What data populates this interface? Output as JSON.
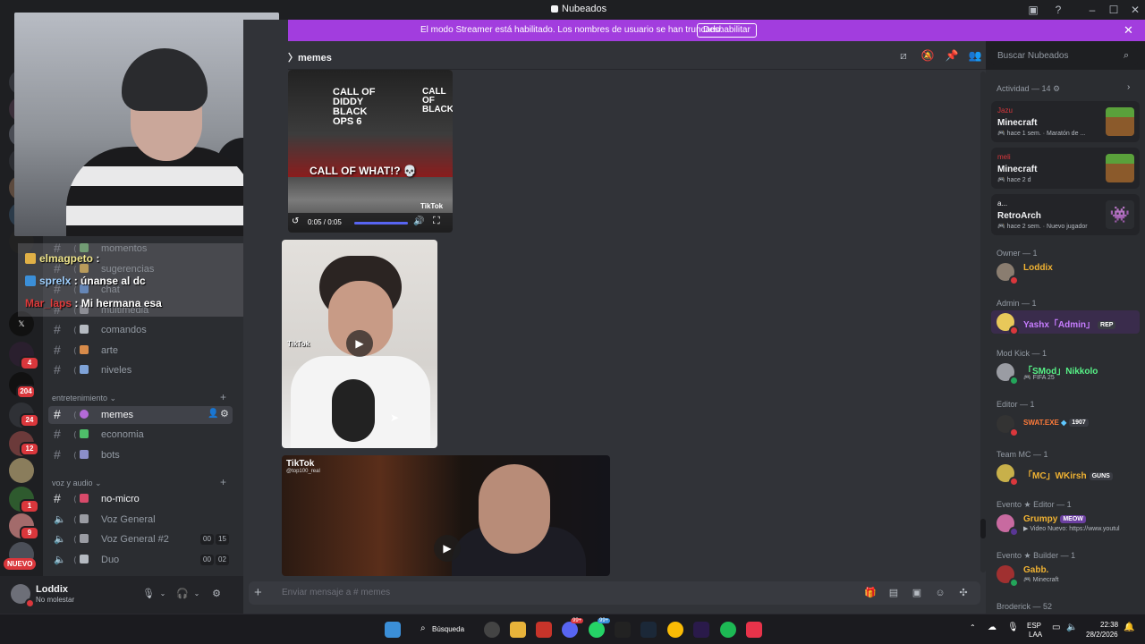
{
  "window": {
    "title": "Nubeados",
    "controls": [
      "–",
      "☐",
      "✕"
    ]
  },
  "streamer_banner": {
    "text": "El modo Streamer está habilitado. Los nombres de usuario se han truncado.",
    "button": "Deshabilitar"
  },
  "channel_header": {
    "name": "memes",
    "search_placeholder": "Buscar Nubeados"
  },
  "rail": {
    "badges": [
      "4",
      "204",
      "24",
      "12",
      "1",
      "9"
    ],
    "new_label": "NUEVO"
  },
  "sidebar": {
    "channels_top": [
      {
        "name": "momentos"
      },
      {
        "name": "sugerencias"
      },
      {
        "name": "chat"
      },
      {
        "name": "multimedia"
      },
      {
        "name": "comandos"
      },
      {
        "name": "arte"
      },
      {
        "name": "niveles"
      }
    ],
    "cat_entretenimiento": "entretenimiento",
    "channels_ent": [
      {
        "name": "memes"
      },
      {
        "name": "economia"
      },
      {
        "name": "bots"
      }
    ],
    "cat_voz": "voz y audio",
    "channels_voz": [
      {
        "name": "no-micro"
      },
      {
        "name": "Voz General"
      },
      {
        "name": "Voz General #2",
        "count_a": "00",
        "count_b": "15"
      },
      {
        "name": "Duo",
        "count_a": "00",
        "count_b": "02"
      }
    ]
  },
  "user_panel": {
    "name": "Loddix",
    "status": "No molestar"
  },
  "chat_overlay": {
    "lines": [
      {
        "user": "elmagpeto",
        "sep": " : ",
        "msg": ""
      },
      {
        "user": "sprelx",
        "sep": " : ",
        "msg": "únanse al dc"
      },
      {
        "user": "Mar_laps",
        "sep": " : ",
        "msg": "Mi hermana esa"
      }
    ]
  },
  "media": {
    "video1": {
      "caption": "CALL OF WHAT!? 💀",
      "sign": "CALL OF DIDDY BLACK OPS 6",
      "sign2": "CALL OF BLACK",
      "source": "TikTok",
      "time": "0:05 / 0:05",
      "progress": 1.0
    },
    "video2": {
      "source": "TikTok"
    },
    "video3": {
      "source": "TikTok",
      "handle": "@top100_real"
    }
  },
  "composer": {
    "placeholder": "Enviar mensaje a #  memes"
  },
  "members": {
    "activity_header": "Actividad — 14",
    "activities": [
      {
        "user": "Jazu",
        "game": "Minecraft",
        "time": "hace 1 sem.",
        "extra": "Maratón de ..."
      },
      {
        "user": "meli",
        "game": "Minecraft",
        "time": "hace 2 d",
        "extra": ""
      },
      {
        "user": "a...",
        "game": "RetroArch",
        "time": "hace 2 sem.",
        "extra": "Nuevo jugador"
      }
    ],
    "groups": [
      {
        "header": "Owner — 1",
        "members": [
          {
            "name": "Loddix",
            "color": "#f0b232",
            "sub": "",
            "tag": ""
          }
        ]
      },
      {
        "header": "Admin — 1",
        "members": [
          {
            "name": "Yashx「Admin」",
            "color": "#c77dff",
            "sub": "",
            "tag": "REP"
          }
        ]
      },
      {
        "header": "Mod Kick — 1",
        "members": [
          {
            "name": "「SMod」Nikkolo",
            "color": "#57f287",
            "sub": "FIFA 25",
            "tag": ""
          }
        ]
      },
      {
        "header": "Editor — 1",
        "members": [
          {
            "name": "SWAT.EXE",
            "color": "#ff7b3a",
            "sub": "",
            "tag": "1907"
          }
        ]
      },
      {
        "header": "Team MC — 1",
        "members": [
          {
            "name": "「MC」WKirsh",
            "color": "#f0b232",
            "sub": "",
            "tag": "GUNS"
          }
        ]
      },
      {
        "header": "Evento ★ Editor — 1",
        "members": [
          {
            "name": "Grumpy",
            "color": "#f0b232",
            "sub": "Video Nuevo: https://www.youtul",
            "tag": "MEOW"
          }
        ]
      },
      {
        "header": "Evento ★ Builder — 1",
        "members": [
          {
            "name": "Gabb.",
            "color": "#f0b232",
            "sub": "Minecraft",
            "tag": ""
          }
        ]
      }
    ],
    "footer": "Broderick — 52"
  },
  "taskbar": {
    "search": "Búsqueda",
    "lang": "ESP",
    "lang2": "LAA",
    "time": "22:38",
    "date": "28/2/2026",
    "badge_a": "99+",
    "badge_b": "99+"
  }
}
